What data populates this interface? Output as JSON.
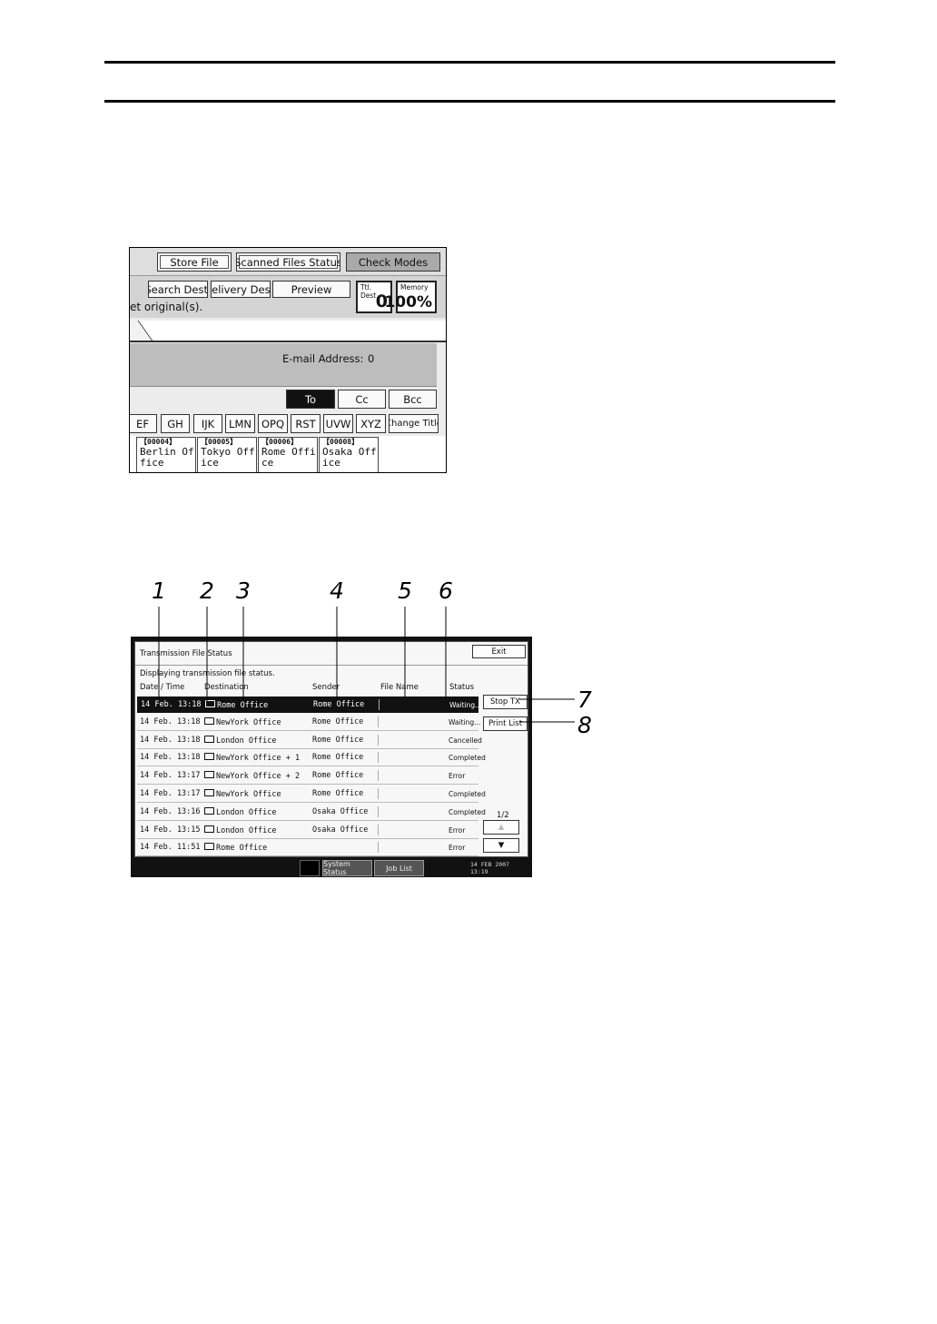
{
  "screen1": {
    "top_buttons": [
      "Store File",
      "Scanned Files Status",
      "Check Modes"
    ],
    "row_buttons": [
      "Search Dest.",
      "Delivery Dest.",
      "Preview"
    ],
    "counters": [
      {
        "label": "Ttl. Dest.",
        "value": "0"
      },
      {
        "label": "Memory",
        "value": "100%"
      }
    ],
    "message": "et original(s).",
    "address_label": "E-mail Address:",
    "address_count": "0",
    "recipient_buttons": [
      "To",
      "Cc",
      "Bcc"
    ],
    "alpha_keys": [
      "EF",
      "GH",
      "IJK",
      "LMN",
      "OPQ",
      "RST",
      "UVW",
      "XYZ"
    ],
    "change_title": "Change Title",
    "entries": [
      {
        "id": "【00004】",
        "name": "Berlin Office"
      },
      {
        "id": "【00005】",
        "name": "Tokyo Office"
      },
      {
        "id": "【00006】",
        "name": "Rome Office"
      },
      {
        "id": "【00008】",
        "name": "Osaka Office"
      }
    ]
  },
  "screen2": {
    "title": "Transmission File Status",
    "subtitle": "Displaying transmission file status.",
    "exit_label": "Exit",
    "columns": {
      "date": "Date / Time",
      "destination": "Destination",
      "sender": "Sender",
      "file": "File Name",
      "status": "Status"
    },
    "rows": [
      {
        "date": "14 Feb. 13:18",
        "icon": "folder",
        "dest": "Rome Office",
        "sender": "Rome Office",
        "status": "Waiting...",
        "selected": true
      },
      {
        "date": "14 Feb. 13:18",
        "icon": "folder",
        "dest": "NewYork Office",
        "sender": "Rome Office",
        "status": "Waiting..."
      },
      {
        "date": "14 Feb. 13:18",
        "icon": "folder",
        "dest": "London Office",
        "sender": "Rome Office",
        "status": "Cancelled"
      },
      {
        "date": "14 Feb. 13:18",
        "icon": "mail",
        "dest": "NewYork Office  + 1",
        "sender": "Rome Office",
        "status": "Completed"
      },
      {
        "date": "14 Feb. 13:17",
        "icon": "mail",
        "dest": "NewYork Office  + 2",
        "sender": "Rome Office",
        "status": "Error"
      },
      {
        "date": "14 Feb. 13:17",
        "icon": "mail",
        "dest": "NewYork Office",
        "sender": "Rome Office",
        "status": "Completed"
      },
      {
        "date": "14 Feb. 13:16",
        "icon": "mail",
        "dest": "London Office",
        "sender": "Osaka Office",
        "status": "Completed"
      },
      {
        "date": "14 Feb. 13:15",
        "icon": "mail",
        "dest": "London Office",
        "sender": "Osaka Office",
        "status": "Error"
      },
      {
        "date": "14 Feb. 11:51",
        "icon": "folder",
        "dest": "Rome Office",
        "sender": "",
        "status": "Error"
      }
    ],
    "stop_tx_label": "Stop TX",
    "print_list_label": "Print List",
    "page": "1/2",
    "system_status_label": "System Status",
    "job_list_label": "Job List",
    "date_line": "14 FEB  2007",
    "time_line": "13:19"
  },
  "callouts": [
    "1",
    "2",
    "3",
    "4",
    "5",
    "6",
    "7",
    "8"
  ]
}
